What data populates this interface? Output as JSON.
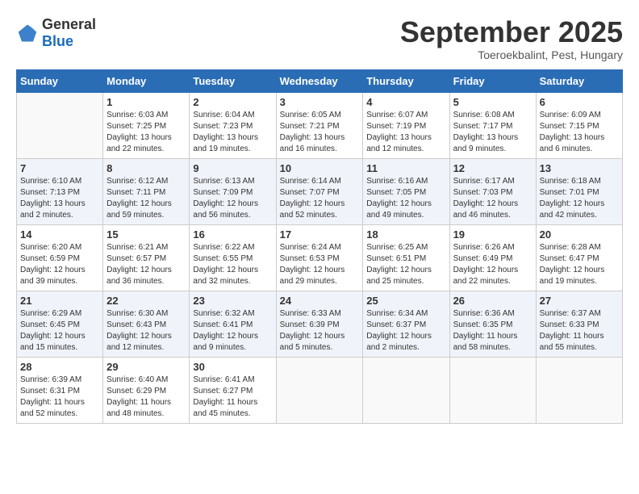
{
  "header": {
    "logo_general": "General",
    "logo_blue": "Blue",
    "month": "September 2025",
    "location": "Toeroekbalint, Pest, Hungary"
  },
  "days_of_week": [
    "Sunday",
    "Monday",
    "Tuesday",
    "Wednesday",
    "Thursday",
    "Friday",
    "Saturday"
  ],
  "weeks": [
    [
      {
        "day": "",
        "sunrise": "",
        "sunset": "",
        "daylight": ""
      },
      {
        "day": "1",
        "sunrise": "Sunrise: 6:03 AM",
        "sunset": "Sunset: 7:25 PM",
        "daylight": "Daylight: 13 hours and 22 minutes."
      },
      {
        "day": "2",
        "sunrise": "Sunrise: 6:04 AM",
        "sunset": "Sunset: 7:23 PM",
        "daylight": "Daylight: 13 hours and 19 minutes."
      },
      {
        "day": "3",
        "sunrise": "Sunrise: 6:05 AM",
        "sunset": "Sunset: 7:21 PM",
        "daylight": "Daylight: 13 hours and 16 minutes."
      },
      {
        "day": "4",
        "sunrise": "Sunrise: 6:07 AM",
        "sunset": "Sunset: 7:19 PM",
        "daylight": "Daylight: 13 hours and 12 minutes."
      },
      {
        "day": "5",
        "sunrise": "Sunrise: 6:08 AM",
        "sunset": "Sunset: 7:17 PM",
        "daylight": "Daylight: 13 hours and 9 minutes."
      },
      {
        "day": "6",
        "sunrise": "Sunrise: 6:09 AM",
        "sunset": "Sunset: 7:15 PM",
        "daylight": "Daylight: 13 hours and 6 minutes."
      }
    ],
    [
      {
        "day": "7",
        "sunrise": "Sunrise: 6:10 AM",
        "sunset": "Sunset: 7:13 PM",
        "daylight": "Daylight: 13 hours and 2 minutes."
      },
      {
        "day": "8",
        "sunrise": "Sunrise: 6:12 AM",
        "sunset": "Sunset: 7:11 PM",
        "daylight": "Daylight: 12 hours and 59 minutes."
      },
      {
        "day": "9",
        "sunrise": "Sunrise: 6:13 AM",
        "sunset": "Sunset: 7:09 PM",
        "daylight": "Daylight: 12 hours and 56 minutes."
      },
      {
        "day": "10",
        "sunrise": "Sunrise: 6:14 AM",
        "sunset": "Sunset: 7:07 PM",
        "daylight": "Daylight: 12 hours and 52 minutes."
      },
      {
        "day": "11",
        "sunrise": "Sunrise: 6:16 AM",
        "sunset": "Sunset: 7:05 PM",
        "daylight": "Daylight: 12 hours and 49 minutes."
      },
      {
        "day": "12",
        "sunrise": "Sunrise: 6:17 AM",
        "sunset": "Sunset: 7:03 PM",
        "daylight": "Daylight: 12 hours and 46 minutes."
      },
      {
        "day": "13",
        "sunrise": "Sunrise: 6:18 AM",
        "sunset": "Sunset: 7:01 PM",
        "daylight": "Daylight: 12 hours and 42 minutes."
      }
    ],
    [
      {
        "day": "14",
        "sunrise": "Sunrise: 6:20 AM",
        "sunset": "Sunset: 6:59 PM",
        "daylight": "Daylight: 12 hours and 39 minutes."
      },
      {
        "day": "15",
        "sunrise": "Sunrise: 6:21 AM",
        "sunset": "Sunset: 6:57 PM",
        "daylight": "Daylight: 12 hours and 36 minutes."
      },
      {
        "day": "16",
        "sunrise": "Sunrise: 6:22 AM",
        "sunset": "Sunset: 6:55 PM",
        "daylight": "Daylight: 12 hours and 32 minutes."
      },
      {
        "day": "17",
        "sunrise": "Sunrise: 6:24 AM",
        "sunset": "Sunset: 6:53 PM",
        "daylight": "Daylight: 12 hours and 29 minutes."
      },
      {
        "day": "18",
        "sunrise": "Sunrise: 6:25 AM",
        "sunset": "Sunset: 6:51 PM",
        "daylight": "Daylight: 12 hours and 25 minutes."
      },
      {
        "day": "19",
        "sunrise": "Sunrise: 6:26 AM",
        "sunset": "Sunset: 6:49 PM",
        "daylight": "Daylight: 12 hours and 22 minutes."
      },
      {
        "day": "20",
        "sunrise": "Sunrise: 6:28 AM",
        "sunset": "Sunset: 6:47 PM",
        "daylight": "Daylight: 12 hours and 19 minutes."
      }
    ],
    [
      {
        "day": "21",
        "sunrise": "Sunrise: 6:29 AM",
        "sunset": "Sunset: 6:45 PM",
        "daylight": "Daylight: 12 hours and 15 minutes."
      },
      {
        "day": "22",
        "sunrise": "Sunrise: 6:30 AM",
        "sunset": "Sunset: 6:43 PM",
        "daylight": "Daylight: 12 hours and 12 minutes."
      },
      {
        "day": "23",
        "sunrise": "Sunrise: 6:32 AM",
        "sunset": "Sunset: 6:41 PM",
        "daylight": "Daylight: 12 hours and 9 minutes."
      },
      {
        "day": "24",
        "sunrise": "Sunrise: 6:33 AM",
        "sunset": "Sunset: 6:39 PM",
        "daylight": "Daylight: 12 hours and 5 minutes."
      },
      {
        "day": "25",
        "sunrise": "Sunrise: 6:34 AM",
        "sunset": "Sunset: 6:37 PM",
        "daylight": "Daylight: 12 hours and 2 minutes."
      },
      {
        "day": "26",
        "sunrise": "Sunrise: 6:36 AM",
        "sunset": "Sunset: 6:35 PM",
        "daylight": "Daylight: 11 hours and 58 minutes."
      },
      {
        "day": "27",
        "sunrise": "Sunrise: 6:37 AM",
        "sunset": "Sunset: 6:33 PM",
        "daylight": "Daylight: 11 hours and 55 minutes."
      }
    ],
    [
      {
        "day": "28",
        "sunrise": "Sunrise: 6:39 AM",
        "sunset": "Sunset: 6:31 PM",
        "daylight": "Daylight: 11 hours and 52 minutes."
      },
      {
        "day": "29",
        "sunrise": "Sunrise: 6:40 AM",
        "sunset": "Sunset: 6:29 PM",
        "daylight": "Daylight: 11 hours and 48 minutes."
      },
      {
        "day": "30",
        "sunrise": "Sunrise: 6:41 AM",
        "sunset": "Sunset: 6:27 PM",
        "daylight": "Daylight: 11 hours and 45 minutes."
      },
      {
        "day": "",
        "sunrise": "",
        "sunset": "",
        "daylight": ""
      },
      {
        "day": "",
        "sunrise": "",
        "sunset": "",
        "daylight": ""
      },
      {
        "day": "",
        "sunrise": "",
        "sunset": "",
        "daylight": ""
      },
      {
        "day": "",
        "sunrise": "",
        "sunset": "",
        "daylight": ""
      }
    ]
  ]
}
